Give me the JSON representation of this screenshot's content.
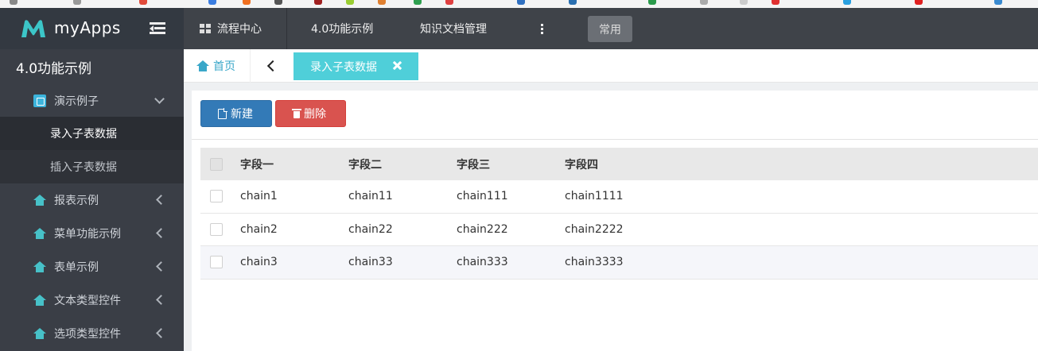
{
  "app": {
    "name": "myApps"
  },
  "topnav": {
    "items": [
      {
        "label": "流程中心",
        "icon": "grid-icon"
      },
      {
        "label": "4.0功能示例"
      },
      {
        "label": "知识文档管理"
      }
    ],
    "more_icon": "more-vertical-icon",
    "common_label": "常用"
  },
  "sidebar": {
    "title": "4.0功能示例",
    "group": {
      "label": "演示例子",
      "icon": "cube-icon"
    },
    "subitems": [
      {
        "label": "录入子表数据",
        "active": true
      },
      {
        "label": "插入子表数据",
        "active": false
      }
    ],
    "items": [
      {
        "label": "报表示例",
        "icon": "home-icon"
      },
      {
        "label": "菜单功能示例",
        "icon": "home-icon"
      },
      {
        "label": "表单示例",
        "icon": "home-icon"
      },
      {
        "label": "文本类型控件",
        "icon": "home-icon"
      },
      {
        "label": "选项类型控件",
        "icon": "home-icon"
      }
    ]
  },
  "tabs": {
    "home_label": "首页",
    "active_label": "录入子表数据"
  },
  "toolbar": {
    "new_label": "新建",
    "delete_label": "删除"
  },
  "table": {
    "columns": [
      "字段一",
      "字段二",
      "字段三",
      "字段四"
    ],
    "rows": [
      [
        "chain1",
        "chain11",
        "chain111",
        "chain1111"
      ],
      [
        "chain2",
        "chain22",
        "chain222",
        "chain2222"
      ],
      [
        "chain3",
        "chain33",
        "chain333",
        "chain3333"
      ]
    ]
  },
  "colors": {
    "header_bg": "#3f4349",
    "sidebar_bg": "#3a3e46",
    "accent_teal": "#4fcfd9",
    "primary_blue": "#337ab7",
    "danger_red": "#d9534f"
  }
}
